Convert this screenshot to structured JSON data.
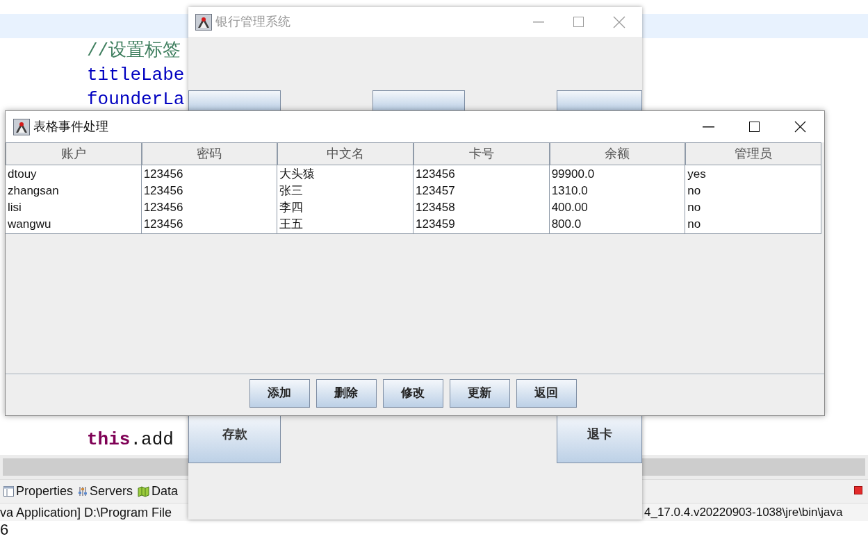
{
  "editor": {
    "lines_top": [
      {
        "highlighted": true
      },
      {
        "highlighted": false,
        "segments": [
          {
            "kind": "comment",
            "text": "//设置标签"
          }
        ]
      },
      {
        "highlighted": false,
        "segments": [
          {
            "kind": "field",
            "text": "titleLabe"
          }
        ]
      },
      {
        "highlighted": false,
        "segments": [
          {
            "kind": "field",
            "text": "founderLa"
          }
        ]
      }
    ],
    "lines_bottom": [
      {
        "highlighted": false,
        "segments": [
          {
            "kind": "keyword",
            "text": "this"
          },
          {
            "kind": "plain",
            "text": ".add"
          }
        ]
      }
    ]
  },
  "bottom_panel": {
    "tabs": [
      {
        "label": "Properties"
      },
      {
        "label": "Servers"
      },
      {
        "label": "Data"
      }
    ],
    "console_left": "va Application] D:\\Program File",
    "console_right": "4_17.0.4.v20220903-1038\\jre\\bin\\java",
    "console_output": "6"
  },
  "bank_window": {
    "title": "银行管理系统",
    "active": false,
    "buttons": [
      {
        "kind": "covered"
      },
      {
        "kind": "covered"
      },
      {
        "kind": "covered"
      },
      {
        "kind": "labeled",
        "label": "存款"
      },
      {
        "kind": "labeled",
        "label": "退卡"
      }
    ]
  },
  "table_window": {
    "title": "表格事件处理",
    "active": true,
    "table": {
      "columns": [
        "账户",
        "密码",
        "中文名",
        "卡号",
        "余额",
        "管理员"
      ],
      "rows": [
        [
          "dtouy",
          "123456",
          "大头猿",
          "123456",
          "99900.0",
          "yes"
        ],
        [
          "zhangsan",
          "123456",
          "张三",
          "123457",
          "1310.0",
          "no"
        ],
        [
          "lisi",
          "123456",
          "李四",
          "123458",
          "400.00",
          "no"
        ],
        [
          "wangwu",
          "123456",
          "王五",
          "123459",
          "800.0",
          "no"
        ]
      ]
    },
    "buttons": [
      "添加",
      "删除",
      "修改",
      "更新",
      "返回"
    ]
  }
}
